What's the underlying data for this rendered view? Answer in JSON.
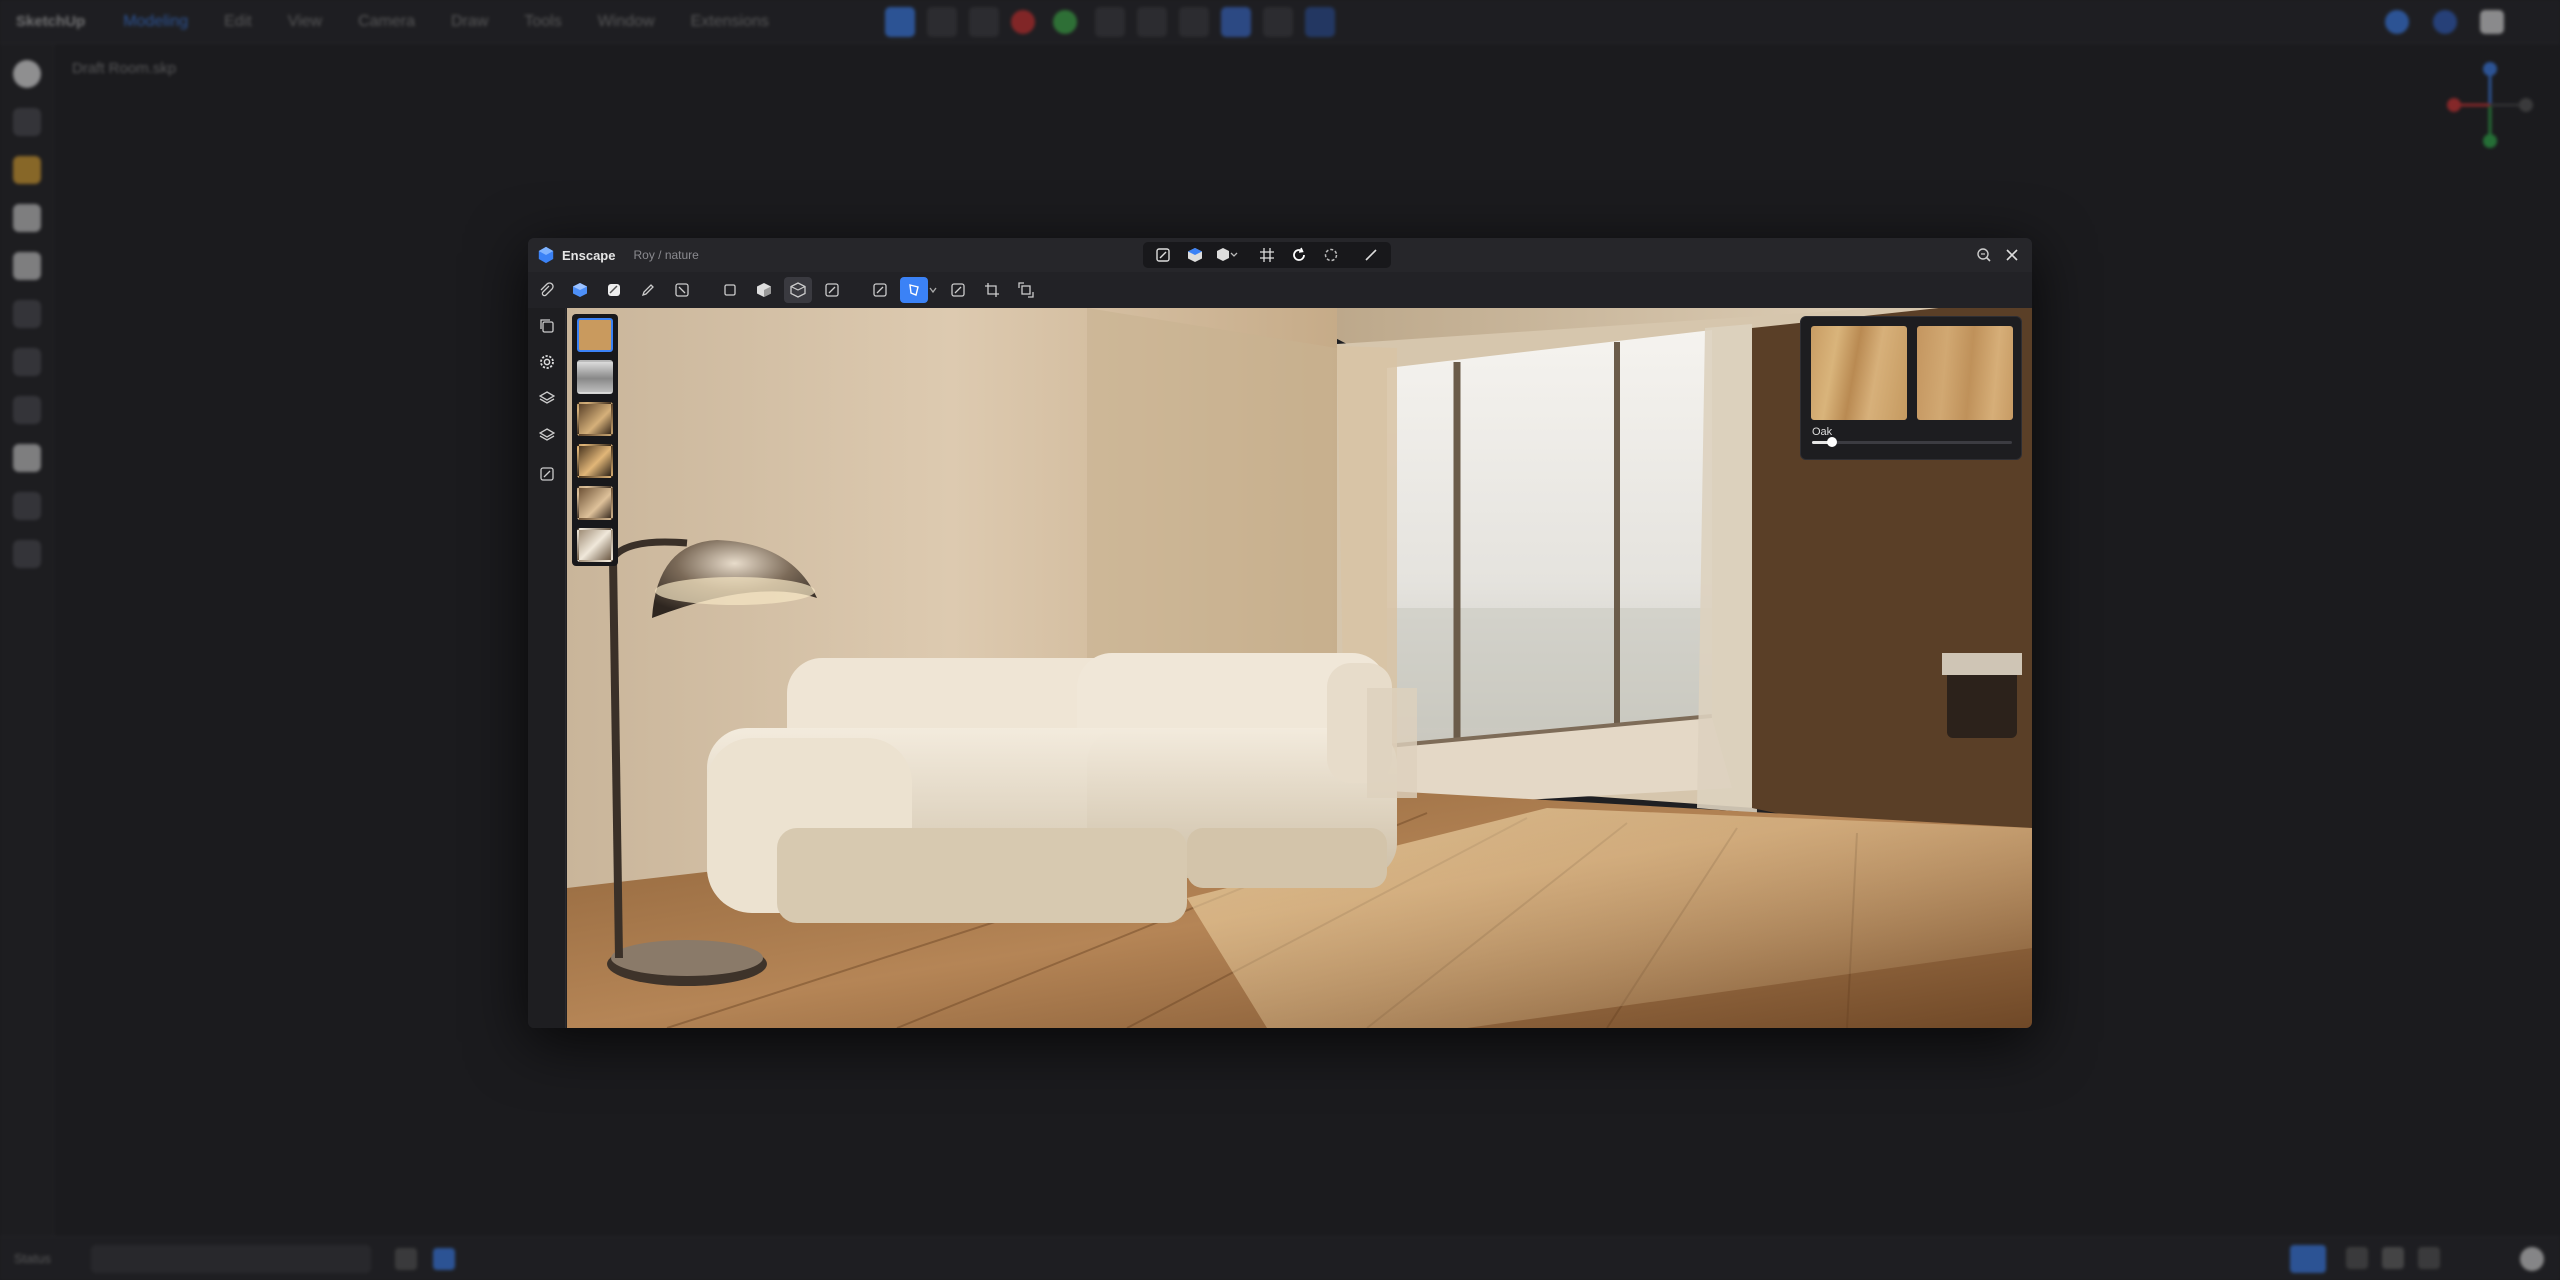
{
  "host": {
    "app_name": "SketchUp",
    "menus": [
      {
        "label": "Modeling",
        "active": true
      },
      {
        "label": "Edit",
        "active": false
      },
      {
        "label": "View",
        "active": false
      },
      {
        "label": "Camera",
        "active": false
      },
      {
        "label": "Draw",
        "active": false
      },
      {
        "label": "Tools",
        "active": false
      },
      {
        "label": "Window",
        "active": false
      },
      {
        "label": "Extensions",
        "active": false
      }
    ],
    "file_name": "Draft Room.skp",
    "status_label": "Status",
    "accent_color": "#3b82f6"
  },
  "window": {
    "title": "Enscape",
    "subtitle": "Roy / nature",
    "close_icon": "close-icon",
    "search_icon": "zoom-icon"
  },
  "materials": {
    "selected_name": "Oak",
    "slider_value": 0.1
  }
}
